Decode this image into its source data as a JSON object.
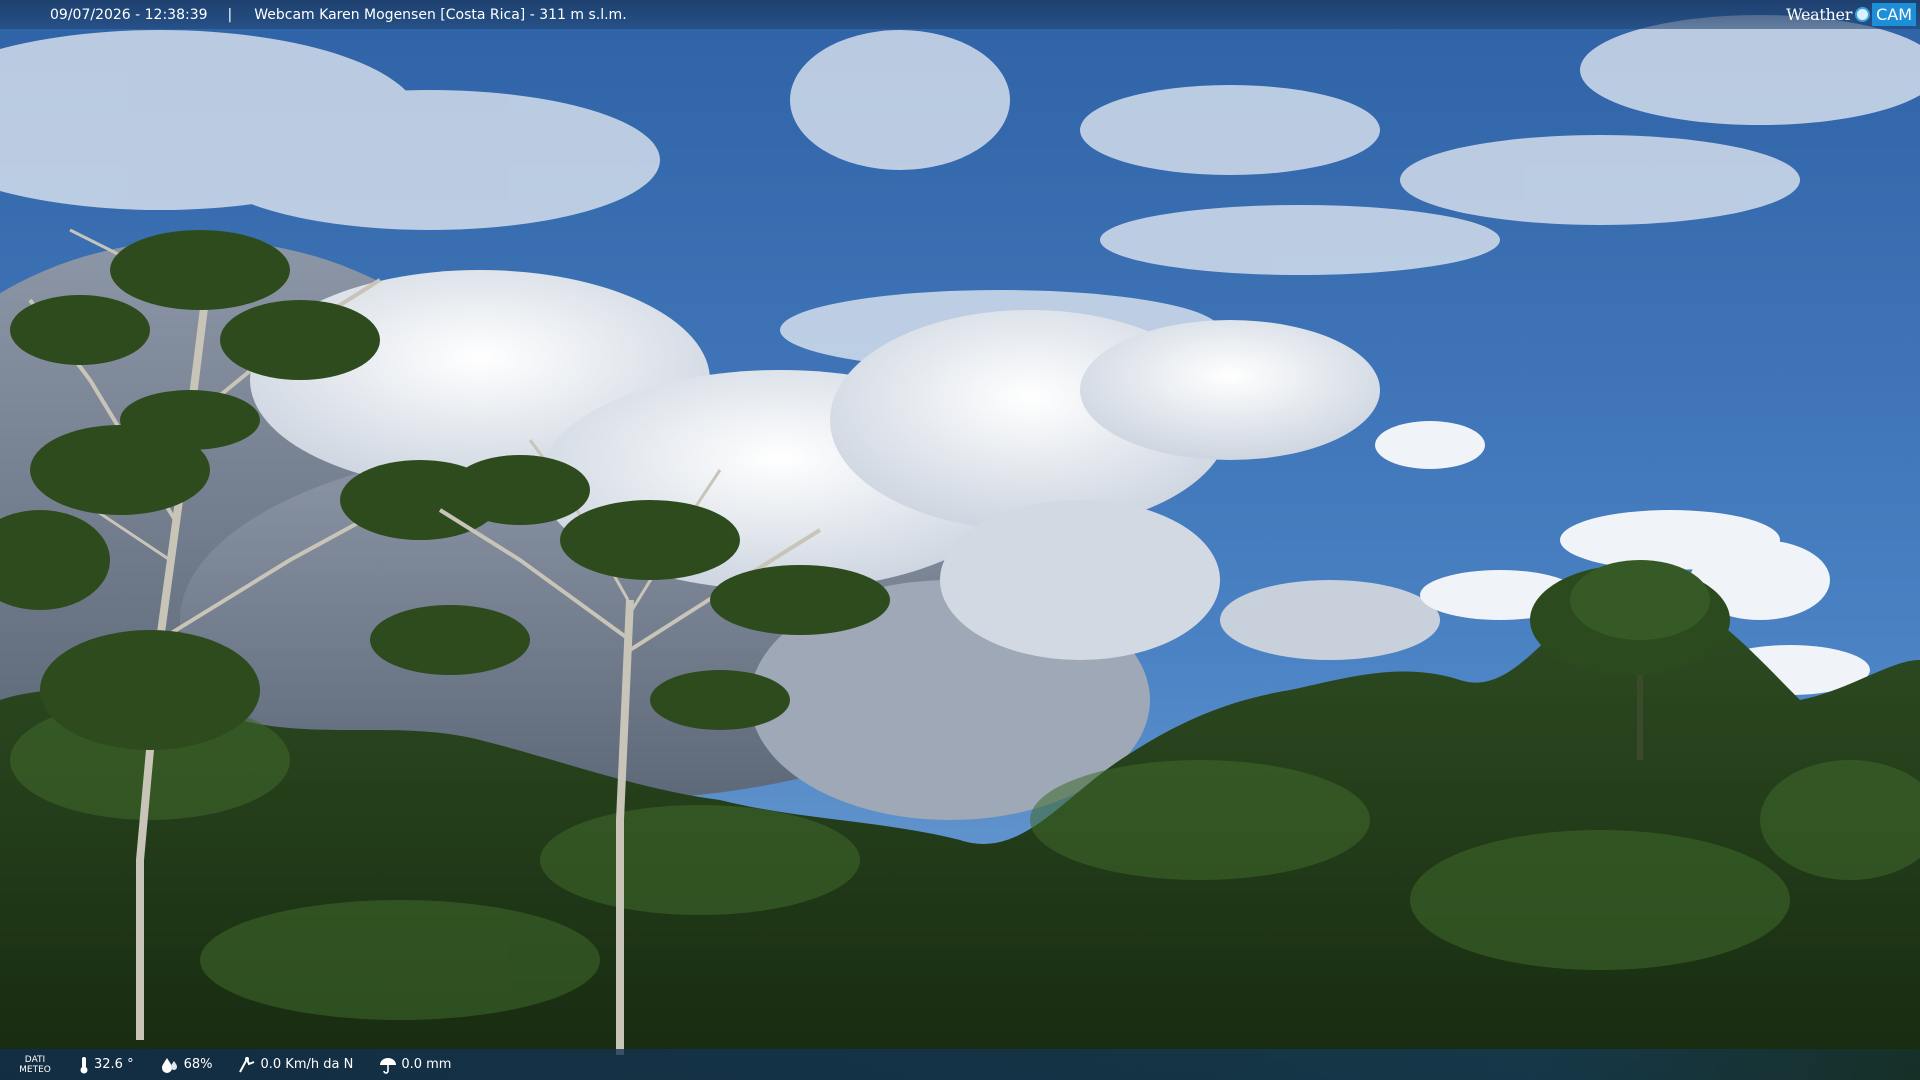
{
  "header": {
    "timestamp": "09/07/2026 - 12:38:39",
    "separator": "|",
    "location": "Webcam Karen Mogensen [Costa Rica] - 311 m s.l.m."
  },
  "logo": {
    "weather": "Weather",
    "cam": "CAM"
  },
  "footer": {
    "dati_line1": "DATI",
    "dati_line2": "METEO",
    "temperature": "32.6 °",
    "humidity": "68%",
    "wind": "0.0 Km/h da N",
    "rain": "0.0 mm"
  },
  "colors": {
    "sky": "#3a6fb0",
    "cloud": "#f2f4f7",
    "forest": "#1f3a17",
    "bar": "#1c3c62"
  }
}
